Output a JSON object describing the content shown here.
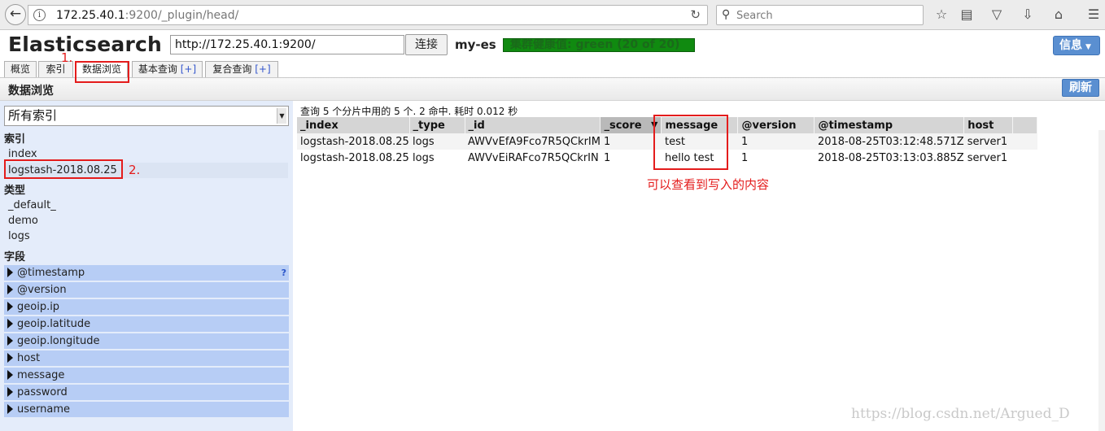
{
  "browser": {
    "url_host": "172.25.40.1",
    "url_path": ":9200/_plugin/head/",
    "search_placeholder": "Search"
  },
  "header": {
    "title": "Elasticsearch",
    "connect_url": "http://172.25.40.1:9200/",
    "connect_label": "连接",
    "cluster_name": "my-es",
    "health_text": "集群健康值: green (20 of 20)",
    "info_label": "信息"
  },
  "tabs": [
    {
      "label": "概览"
    },
    {
      "label": "索引"
    },
    {
      "label": "数据浏览"
    },
    {
      "label": "基本查询",
      "plus": "[+]"
    },
    {
      "label": "复合查询",
      "plus": "[+]"
    }
  ],
  "annotations": {
    "step1": "1.",
    "step2": "2.",
    "note": "可以查看到写入的内容"
  },
  "section": {
    "title": "数据浏览",
    "refresh_label": "刷新"
  },
  "sidebar": {
    "index_select": "所有索引",
    "indices_heading": "索引",
    "indices": [
      "index",
      "logstash-2018.08.25"
    ],
    "types_heading": "类型",
    "types": [
      "_default_",
      "demo",
      "logs"
    ],
    "fields_heading": "字段",
    "fields": [
      "@timestamp",
      "@version",
      "geoip.ip",
      "geoip.latitude",
      "geoip.longitude",
      "host",
      "message",
      "password",
      "username"
    ],
    "help_mark": "?"
  },
  "results": {
    "summary": "查询 5 个分片中用的 5 个. 2 命中. 耗时 0.012 秒",
    "columns": [
      "_index",
      "_type",
      "_id",
      "_score",
      "message",
      "@version",
      "@timestamp",
      "host"
    ],
    "sort_arrow": "▼",
    "rows": [
      [
        "logstash-2018.08.25",
        "logs",
        "AWVvEfA9Fco7R5QCkrIM",
        "1",
        "test",
        "1",
        "2018-08-25T03:12:48.571Z",
        "server1"
      ],
      [
        "logstash-2018.08.25",
        "logs",
        "AWVvEiRAFco7R5QCkrIN",
        "1",
        "hello test",
        "1",
        "2018-08-25T03:13:03.885Z",
        "server1"
      ]
    ]
  },
  "watermark": "https://blog.csdn.net/Argued_D"
}
